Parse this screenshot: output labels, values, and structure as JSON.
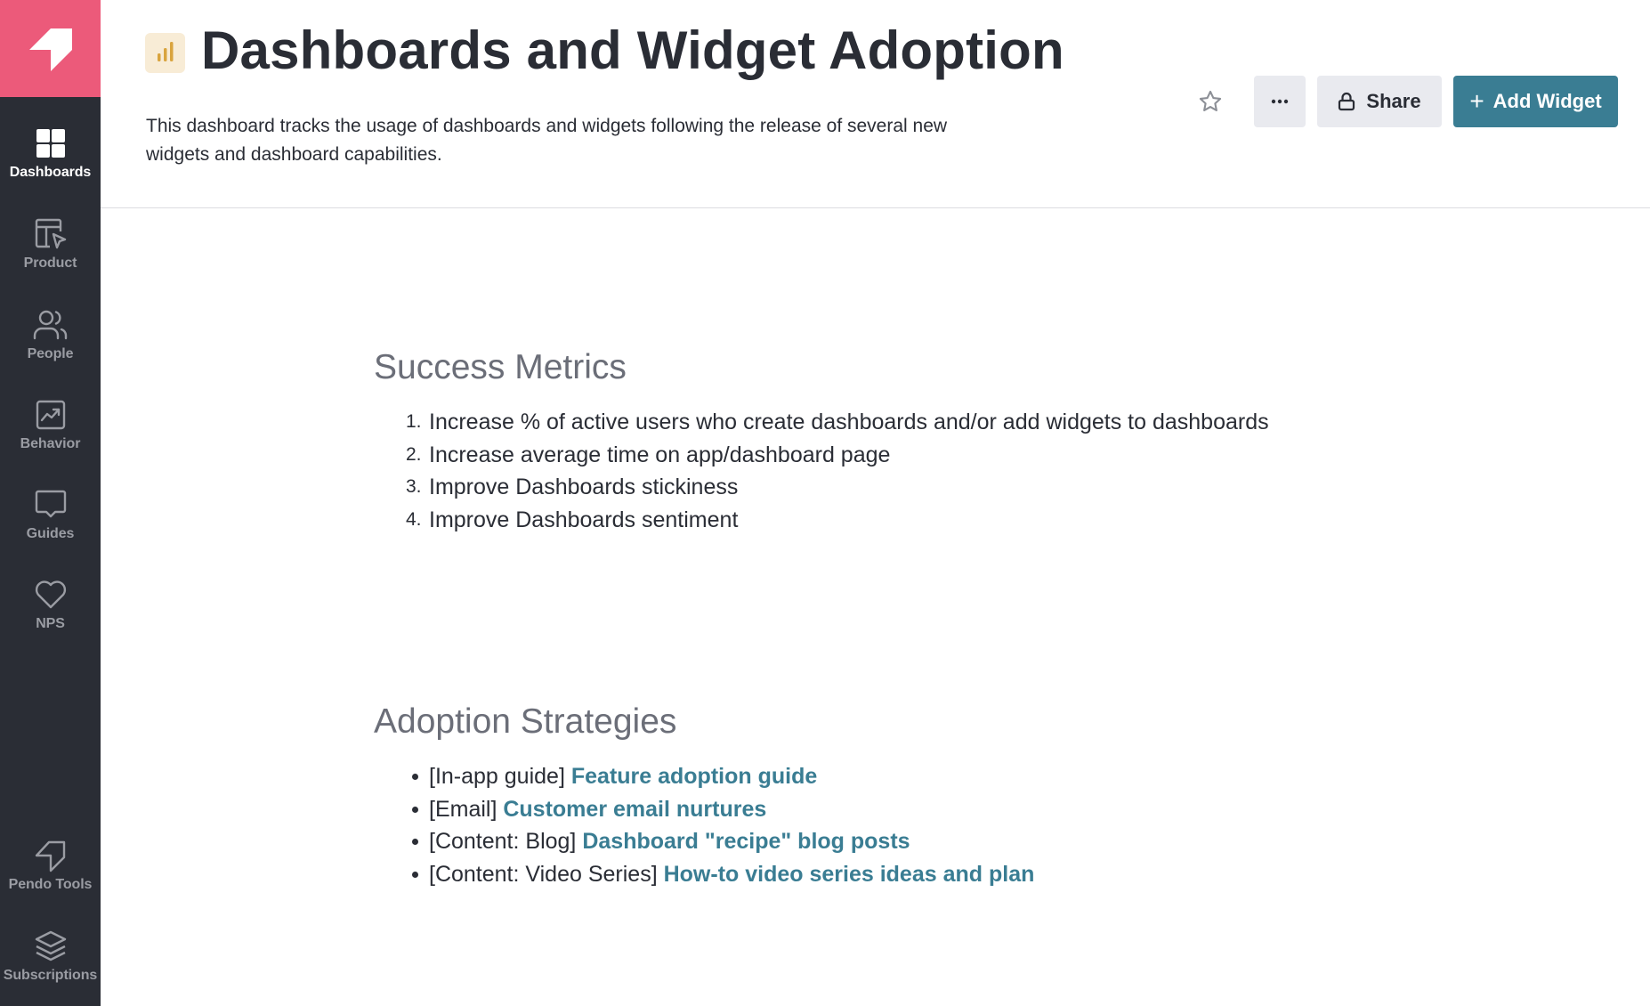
{
  "sidebar": {
    "logo": "pendo-logo",
    "items": [
      {
        "label": "Dashboards",
        "icon": "dashboards-grid-icon",
        "active": true
      },
      {
        "label": "Product",
        "icon": "product-layout-cursor-icon",
        "active": false
      },
      {
        "label": "People",
        "icon": "people-icon",
        "active": false
      },
      {
        "label": "Behavior",
        "icon": "behavior-trend-icon",
        "active": false
      },
      {
        "label": "Guides",
        "icon": "guides-speech-bubble-icon",
        "active": false
      },
      {
        "label": "NPS",
        "icon": "heart-icon",
        "active": false
      }
    ],
    "bottom_items": [
      {
        "label": "Pendo Tools",
        "icon": "pendo-tools-icon"
      },
      {
        "label": "Subscriptions",
        "icon": "layers-icon"
      }
    ]
  },
  "header": {
    "title": "Dashboards and Widget Adoption",
    "title_icon": "bar-chart-icon",
    "description": "This dashboard tracks the usage of dashboards and widgets following the release of several new widgets and dashboard capabilities.",
    "actions": {
      "favorite_icon": "star-icon",
      "more_label": "···",
      "share_label": "Share",
      "add_widget_label": "Add Widget",
      "add_widget_plus": "+"
    }
  },
  "content": {
    "success_metrics": {
      "title": "Success Metrics",
      "items": [
        {
          "number": "1.",
          "text": "Increase % of active users who create dashboards and/or add widgets to dashboards"
        },
        {
          "number": "2.",
          "text": "Increase average time on app/dashboard page"
        },
        {
          "number": "3.",
          "text": "Improve Dashboards stickiness"
        },
        {
          "number": "4.",
          "text": "Improve Dashboards sentiment"
        }
      ]
    },
    "adoption_strategies": {
      "title": "Adoption Strategies",
      "items": [
        {
          "prefix": "[In-app guide]",
          "link": "Feature adoption guide"
        },
        {
          "prefix": "[Email]",
          "link": "Customer email nurtures"
        },
        {
          "prefix": "[Content: Blog]",
          "link": "Dashboard \"recipe\" blog posts"
        },
        {
          "prefix": "[Content: Video Series]",
          "link": "How-to video series ideas and plan"
        }
      ]
    }
  },
  "colors": {
    "brand_pink": "#ec5a7a",
    "sidebar_bg": "#2a2d35",
    "accent_teal": "#3a7d93",
    "title_icon_bg": "#f8ecd6",
    "title_icon_fg": "#d9a43e"
  }
}
